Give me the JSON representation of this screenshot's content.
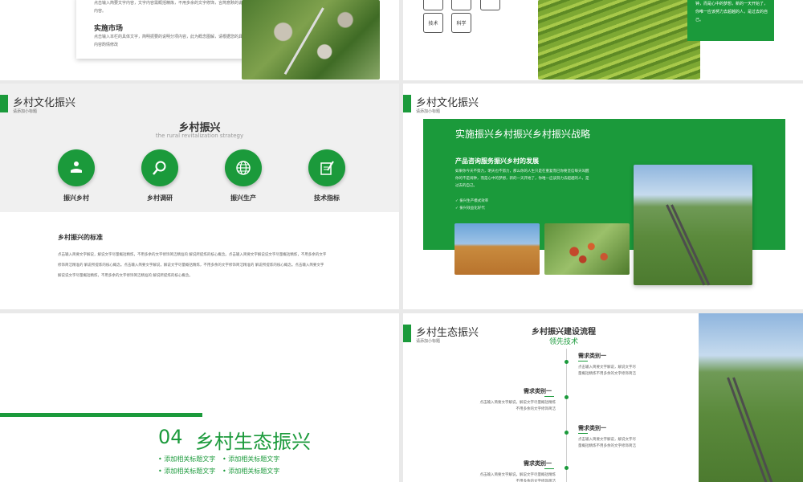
{
  "slide1": {
    "text_top": "点击输入简要文字内容，文字内容需概括精炼，不用多余的文字修饰，言简意赅的说明该项内容。",
    "heading": "实施市场",
    "paragraph": "点击输入本栏的具体文字，简明扼要的说明分项内容，此为概念图解，请根据您的具体内容酌情修改"
  },
  "slide2": {
    "tags": [
      "技术",
      "科学"
    ],
    "green_text": "钟，而是心中的梦想，新的一天开始了，你唯一应该努力去超越的人，是过去的自己。"
  },
  "slide3": {
    "title": "乡村文化振兴",
    "subtitle": "请添加小标题",
    "main_title": "乡村振兴",
    "main_sub": "the rural revitalization strategy",
    "items": [
      {
        "label": "振兴乡村",
        "icon": "hand-person-icon"
      },
      {
        "label": "乡村调研",
        "icon": "magnifier-icon"
      },
      {
        "label": "振兴生产",
        "icon": "globe-icon"
      },
      {
        "label": "技术指标",
        "icon": "pen-notebook-icon"
      }
    ],
    "section_title": "乡村振兴的标准",
    "line1": "点击输入简要文字解说，解说文字尽量概括精炼，不用多余的文字修饰简洁精准的 解说所提炼的核心概念。点击输入简要文字解说说文字尽量概括精炼，不用多余的文字",
    "line2": "修饰简洁精准的 解说所提炼的核心概念。点击输入简要文字解说，解说文字尽量概括精炼，不用多余的文字修饰简洁精准的 解说所提炼的核心概念。点击输入简要文字",
    "line3": "解说说文字尽量概括精炼，不用多余的文字修饰简洁精准的 解说所提炼的核心概念。"
  },
  "slide4": {
    "title": "乡村文化振兴",
    "subtitle": "请添加小标题",
    "heading": "实施振兴乡村振兴乡村振兴战略",
    "subheading": "产品咨询服务振兴乡村的发展",
    "paragraph": "如果你今天不努力，明天也不努力，那么你的人生只是在重复而已你要坚信每天叫醒你的不是闹钟，而是心中的梦想，新的一天开始了，你唯一应该努力去超越的人，是过去的自己。",
    "bullets": [
      "振兴生产模式效率",
      "振兴效益化好代"
    ]
  },
  "slide5": {
    "number": "04",
    "title": "乡村生态振兴",
    "bullets": [
      "添加相关标题文字",
      "添加相关标题文字",
      "添加相关标题文字",
      "添加相关标题文字"
    ]
  },
  "slide6": {
    "title": "乡村生态振兴",
    "subtitle": "请添加小标题",
    "flow_title": "乡村振兴建设流程",
    "flow_sub": "领先技术",
    "nodes": [
      {
        "label": "需求类别一",
        "text": "点击输入简要文字解说，解说文字尽量概括精炼不用多余的文字修饰简洁"
      },
      {
        "label": "需求类别一",
        "text": "点击输入简要文字解说，解说文字尽量概括精炼不用多余的文字修饰简洁"
      },
      {
        "label": "需求类别一",
        "text": "点击输入简要文字解说，解说文字尽量概括精炼不用多余的文字修饰简洁"
      },
      {
        "label": "需求类别一",
        "text": "点击输入简要文字解说，解说文字尽量概括精炼不用多余的文字修饰简洁"
      }
    ]
  },
  "colors": {
    "accent": "#1b9a3b"
  }
}
